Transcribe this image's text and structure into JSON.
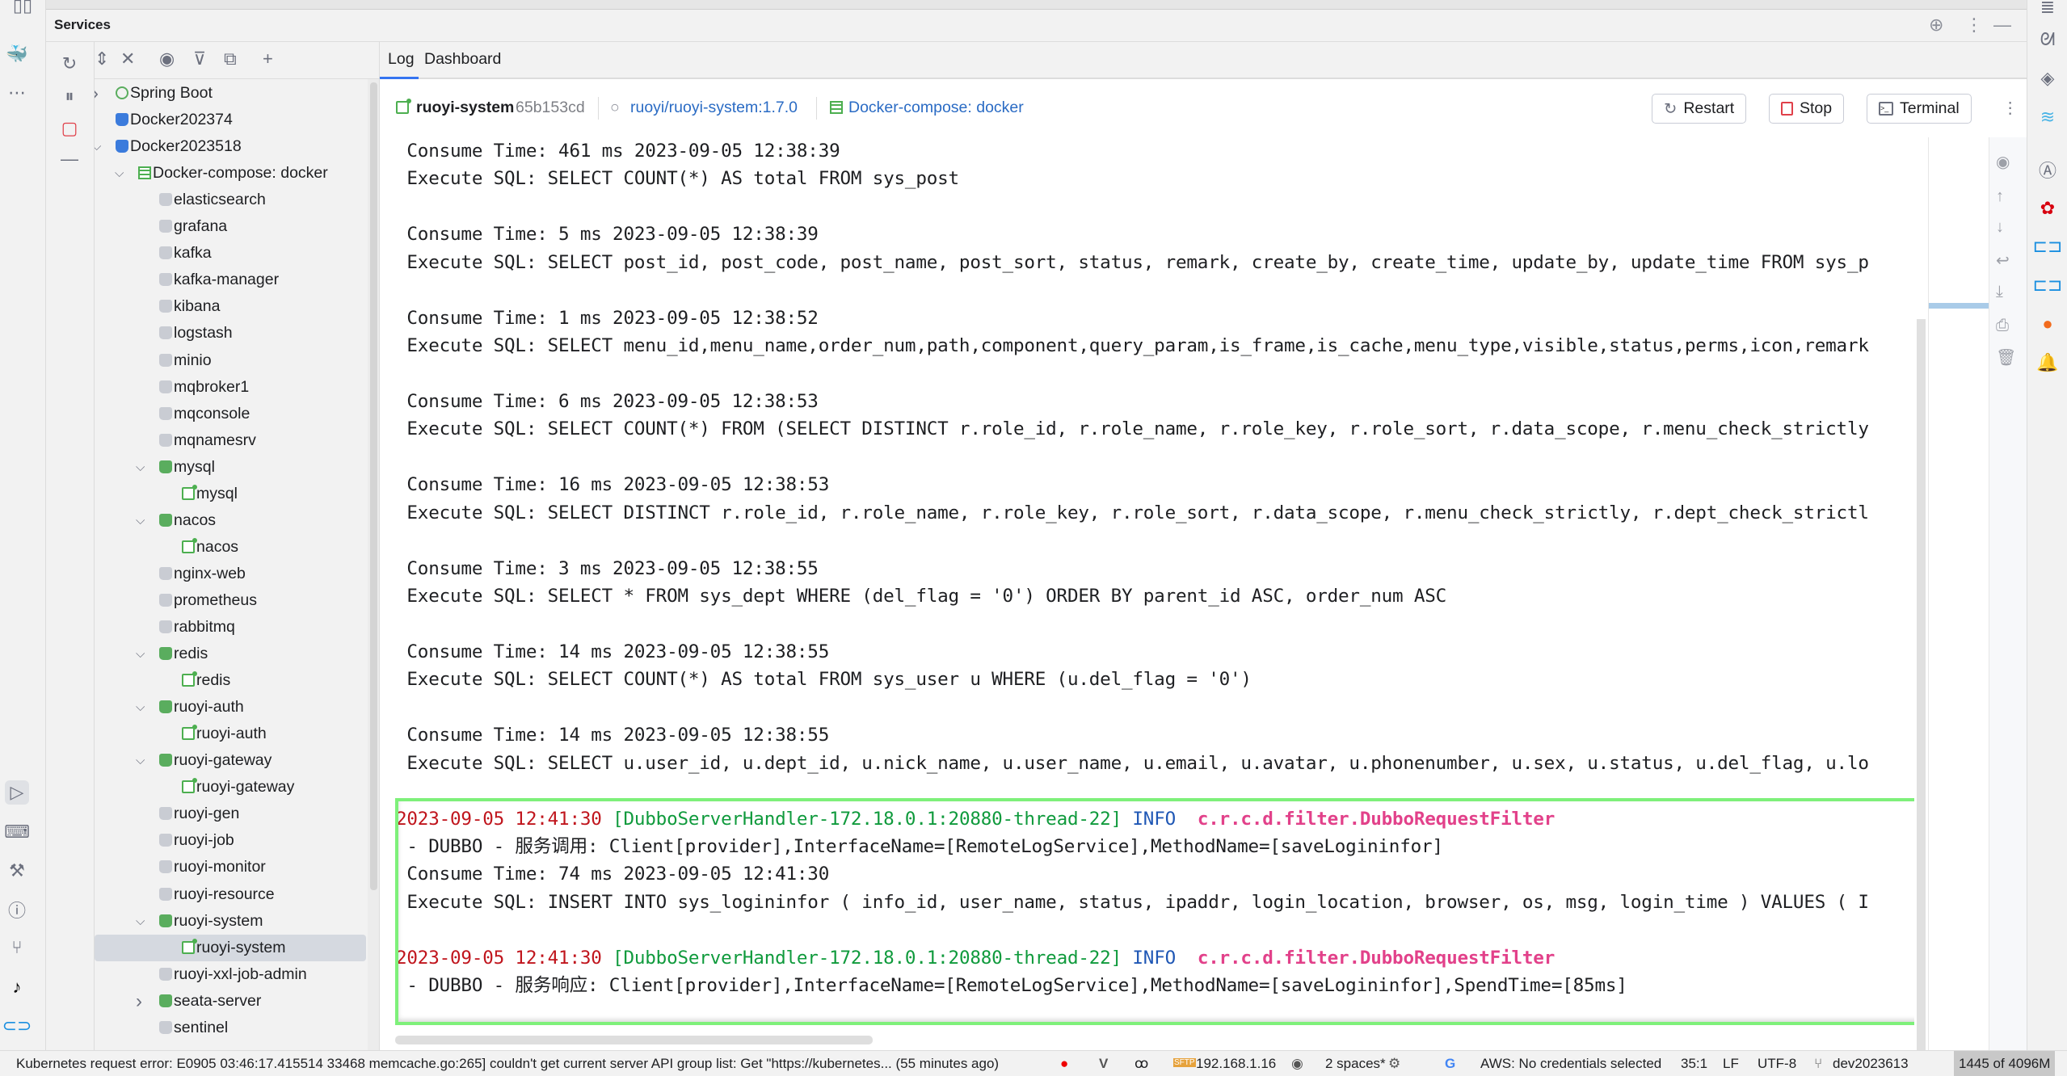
{
  "panel_title": "Services",
  "tabs": [
    {
      "label": "Log",
      "active": true
    },
    {
      "label": "Dashboard",
      "active": false
    }
  ],
  "context": {
    "container_name": "ruoyi-system",
    "container_id": "65b153cd",
    "image": "ruoyi/ruoyi-system:1.7.0",
    "compose": "Docker-compose: docker",
    "restart_label": "Restart",
    "stop_label": "Stop",
    "terminal_label": "Terminal"
  },
  "tree": [
    {
      "label": "Spring Boot",
      "level": 0,
      "arrow": "collapsed",
      "icon": "spring"
    },
    {
      "label": "Docker202374",
      "level": 0,
      "arrow": "none",
      "icon": "dock"
    },
    {
      "label": "Docker2023518",
      "level": 0,
      "arrow": "expanded",
      "icon": "dock"
    },
    {
      "label": "Docker-compose: docker",
      "level": 1,
      "arrow": "expanded",
      "icon": "compose"
    },
    {
      "label": "elasticsearch",
      "level": 2,
      "arrow": "none",
      "icon": "svc"
    },
    {
      "label": "grafana",
      "level": 2,
      "arrow": "none",
      "icon": "svc"
    },
    {
      "label": "kafka",
      "level": 2,
      "arrow": "none",
      "icon": "svc"
    },
    {
      "label": "kafka-manager",
      "level": 2,
      "arrow": "none",
      "icon": "svc"
    },
    {
      "label": "kibana",
      "level": 2,
      "arrow": "none",
      "icon": "svc"
    },
    {
      "label": "logstash",
      "level": 2,
      "arrow": "none",
      "icon": "svc"
    },
    {
      "label": "minio",
      "level": 2,
      "arrow": "none",
      "icon": "svc"
    },
    {
      "label": "mqbroker1",
      "level": 2,
      "arrow": "none",
      "icon": "svc"
    },
    {
      "label": "mqconsole",
      "level": 2,
      "arrow": "none",
      "icon": "svc"
    },
    {
      "label": "mqnamesrv",
      "level": 2,
      "arrow": "none",
      "icon": "svc"
    },
    {
      "label": "mysql",
      "level": 2,
      "arrow": "expanded",
      "icon": "svcg"
    },
    {
      "label": "mysql",
      "level": 3,
      "arrow": "none",
      "icon": "cont"
    },
    {
      "label": "nacos",
      "level": 2,
      "arrow": "expanded",
      "icon": "svcg"
    },
    {
      "label": "nacos",
      "level": 3,
      "arrow": "none",
      "icon": "cont"
    },
    {
      "label": "nginx-web",
      "level": 2,
      "arrow": "none",
      "icon": "svc"
    },
    {
      "label": "prometheus",
      "level": 2,
      "arrow": "none",
      "icon": "svc"
    },
    {
      "label": "rabbitmq",
      "level": 2,
      "arrow": "none",
      "icon": "svc"
    },
    {
      "label": "redis",
      "level": 2,
      "arrow": "expanded",
      "icon": "svcg"
    },
    {
      "label": "redis",
      "level": 3,
      "arrow": "none",
      "icon": "cont"
    },
    {
      "label": "ruoyi-auth",
      "level": 2,
      "arrow": "expanded",
      "icon": "svcg"
    },
    {
      "label": "ruoyi-auth",
      "level": 3,
      "arrow": "none",
      "icon": "cont"
    },
    {
      "label": "ruoyi-gateway",
      "level": 2,
      "arrow": "expanded",
      "icon": "svcg"
    },
    {
      "label": "ruoyi-gateway",
      "level": 3,
      "arrow": "none",
      "icon": "cont"
    },
    {
      "label": "ruoyi-gen",
      "level": 2,
      "arrow": "none",
      "icon": "svc"
    },
    {
      "label": "ruoyi-job",
      "level": 2,
      "arrow": "none",
      "icon": "svc"
    },
    {
      "label": "ruoyi-monitor",
      "level": 2,
      "arrow": "none",
      "icon": "svc"
    },
    {
      "label": "ruoyi-resource",
      "level": 2,
      "arrow": "none",
      "icon": "svc"
    },
    {
      "label": "ruoyi-system",
      "level": 2,
      "arrow": "expanded",
      "icon": "svcg"
    },
    {
      "label": "ruoyi-system",
      "level": 3,
      "arrow": "none",
      "icon": "cont",
      "selected": true
    },
    {
      "label": "ruoyi-xxl-job-admin",
      "level": 2,
      "arrow": "none",
      "icon": "svc"
    },
    {
      "label": "seata-server",
      "level": 2,
      "arrow": "collapsed",
      "icon": "svcg"
    },
    {
      "label": "sentinel",
      "level": 2,
      "arrow": "none",
      "icon": "svc"
    }
  ],
  "log": [
    [
      {
        "t": " Consume Time: 461 ms 2023-09-05 12:38:39"
      }
    ],
    [
      {
        "t": " Execute SQL: SELECT COUNT(*) AS total FROM sys_post"
      }
    ],
    [],
    [
      {
        "t": " Consume Time: 5 ms 2023-09-05 12:38:39"
      }
    ],
    [
      {
        "t": " Execute SQL: SELECT post_id, post_code, post_name, post_sort, status, remark, create_by, create_time, update_by, update_time FROM sys_p"
      }
    ],
    [],
    [
      {
        "t": " Consume Time: 1 ms 2023-09-05 12:38:52"
      }
    ],
    [
      {
        "t": " Execute SQL: SELECT menu_id,menu_name,order_num,path,component,query_param,is_frame,is_cache,menu_type,visible,status,perms,icon,remark"
      }
    ],
    [],
    [
      {
        "t": " Consume Time: 6 ms 2023-09-05 12:38:53"
      }
    ],
    [
      {
        "t": " Execute SQL: SELECT COUNT(*) FROM (SELECT DISTINCT r.role_id, r.role_name, r.role_key, r.role_sort, r.data_scope, r.menu_check_strictly"
      }
    ],
    [],
    [
      {
        "t": " Consume Time: 16 ms 2023-09-05 12:38:53"
      }
    ],
    [
      {
        "t": " Execute SQL: SELECT DISTINCT r.role_id, r.role_name, r.role_key, r.role_sort, r.data_scope, r.menu_check_strictly, r.dept_check_strictl"
      }
    ],
    [],
    [
      {
        "t": " Consume Time: 3 ms 2023-09-05 12:38:55"
      }
    ],
    [
      {
        "t": " Execute SQL: SELECT * FROM sys_dept WHERE (del_flag = '0') ORDER BY parent_id ASC, order_num ASC"
      }
    ],
    [],
    [
      {
        "t": " Consume Time: 14 ms 2023-09-05 12:38:55"
      }
    ],
    [
      {
        "t": " Execute SQL: SELECT COUNT(*) AS total FROM sys_user u WHERE (u.del_flag = '0')"
      }
    ],
    [],
    [
      {
        "t": " Consume Time: 14 ms 2023-09-05 12:38:55"
      }
    ],
    [
      {
        "t": " Execute SQL: SELECT u.user_id, u.dept_id, u.nick_name, u.user_name, u.email, u.avatar, u.phonenumber, u.sex, u.status, u.del_flag, u.lo"
      }
    ],
    [],
    [
      {
        "t": "2023-09-05 12:41:30 ",
        "c": "date"
      },
      {
        "t": "[DubboServerHandler-172.18.0.1:20880-thread-22] ",
        "c": "thread"
      },
      {
        "t": "INFO  ",
        "c": "info"
      },
      {
        "t": "c.r.c.d.filter.DubboRequestFilter",
        "c": "logger"
      }
    ],
    [
      {
        "t": " - DUBBO - 服务调用: Client[provider],InterfaceName=[RemoteLogService],MethodName=[saveLogininfor]"
      }
    ],
    [
      {
        "t": " Consume Time: 74 ms 2023-09-05 12:41:30"
      }
    ],
    [
      {
        "t": " Execute SQL: INSERT INTO sys_logininfor ( info_id, user_name, status, ipaddr, login_location, browser, os, msg, login_time ) VALUES ( I"
      }
    ],
    [],
    [
      {
        "t": "2023-09-05 12:41:30 ",
        "c": "date"
      },
      {
        "t": "[DubboServerHandler-172.18.0.1:20880-thread-22] ",
        "c": "thread"
      },
      {
        "t": "INFO  ",
        "c": "info"
      },
      {
        "t": "c.r.c.d.filter.DubboRequestFilter",
        "c": "logger"
      }
    ],
    [
      {
        "t": " - DUBBO - 服务响应: Client[provider],InterfaceName=[RemoteLogService],MethodName=[saveLogininfor],SpendTime=[85ms]"
      }
    ]
  ],
  "status_bar": {
    "message": "Kubernetes request error: E0905 03:46:17.415514   33468 memcache.go:265] couldn't get current server API group list: Get \"https://kubernetes... (55 minutes ago)",
    "sftp_host": "192.168.1.16",
    "indent": "2 spaces*",
    "aws": "AWS: No credentials selected",
    "position": "35:1",
    "line_sep": "LF",
    "encoding": "UTF-8",
    "branch": "dev2023613",
    "memory": "1445 of 4096M"
  },
  "colors": {
    "accent": "#3574f0",
    "highlight_box": "#7ef07a",
    "log_date": "#c0151d",
    "log_thread": "#0f9a3c",
    "log_level": "#1f57b5",
    "log_logger": "#e2418a"
  }
}
